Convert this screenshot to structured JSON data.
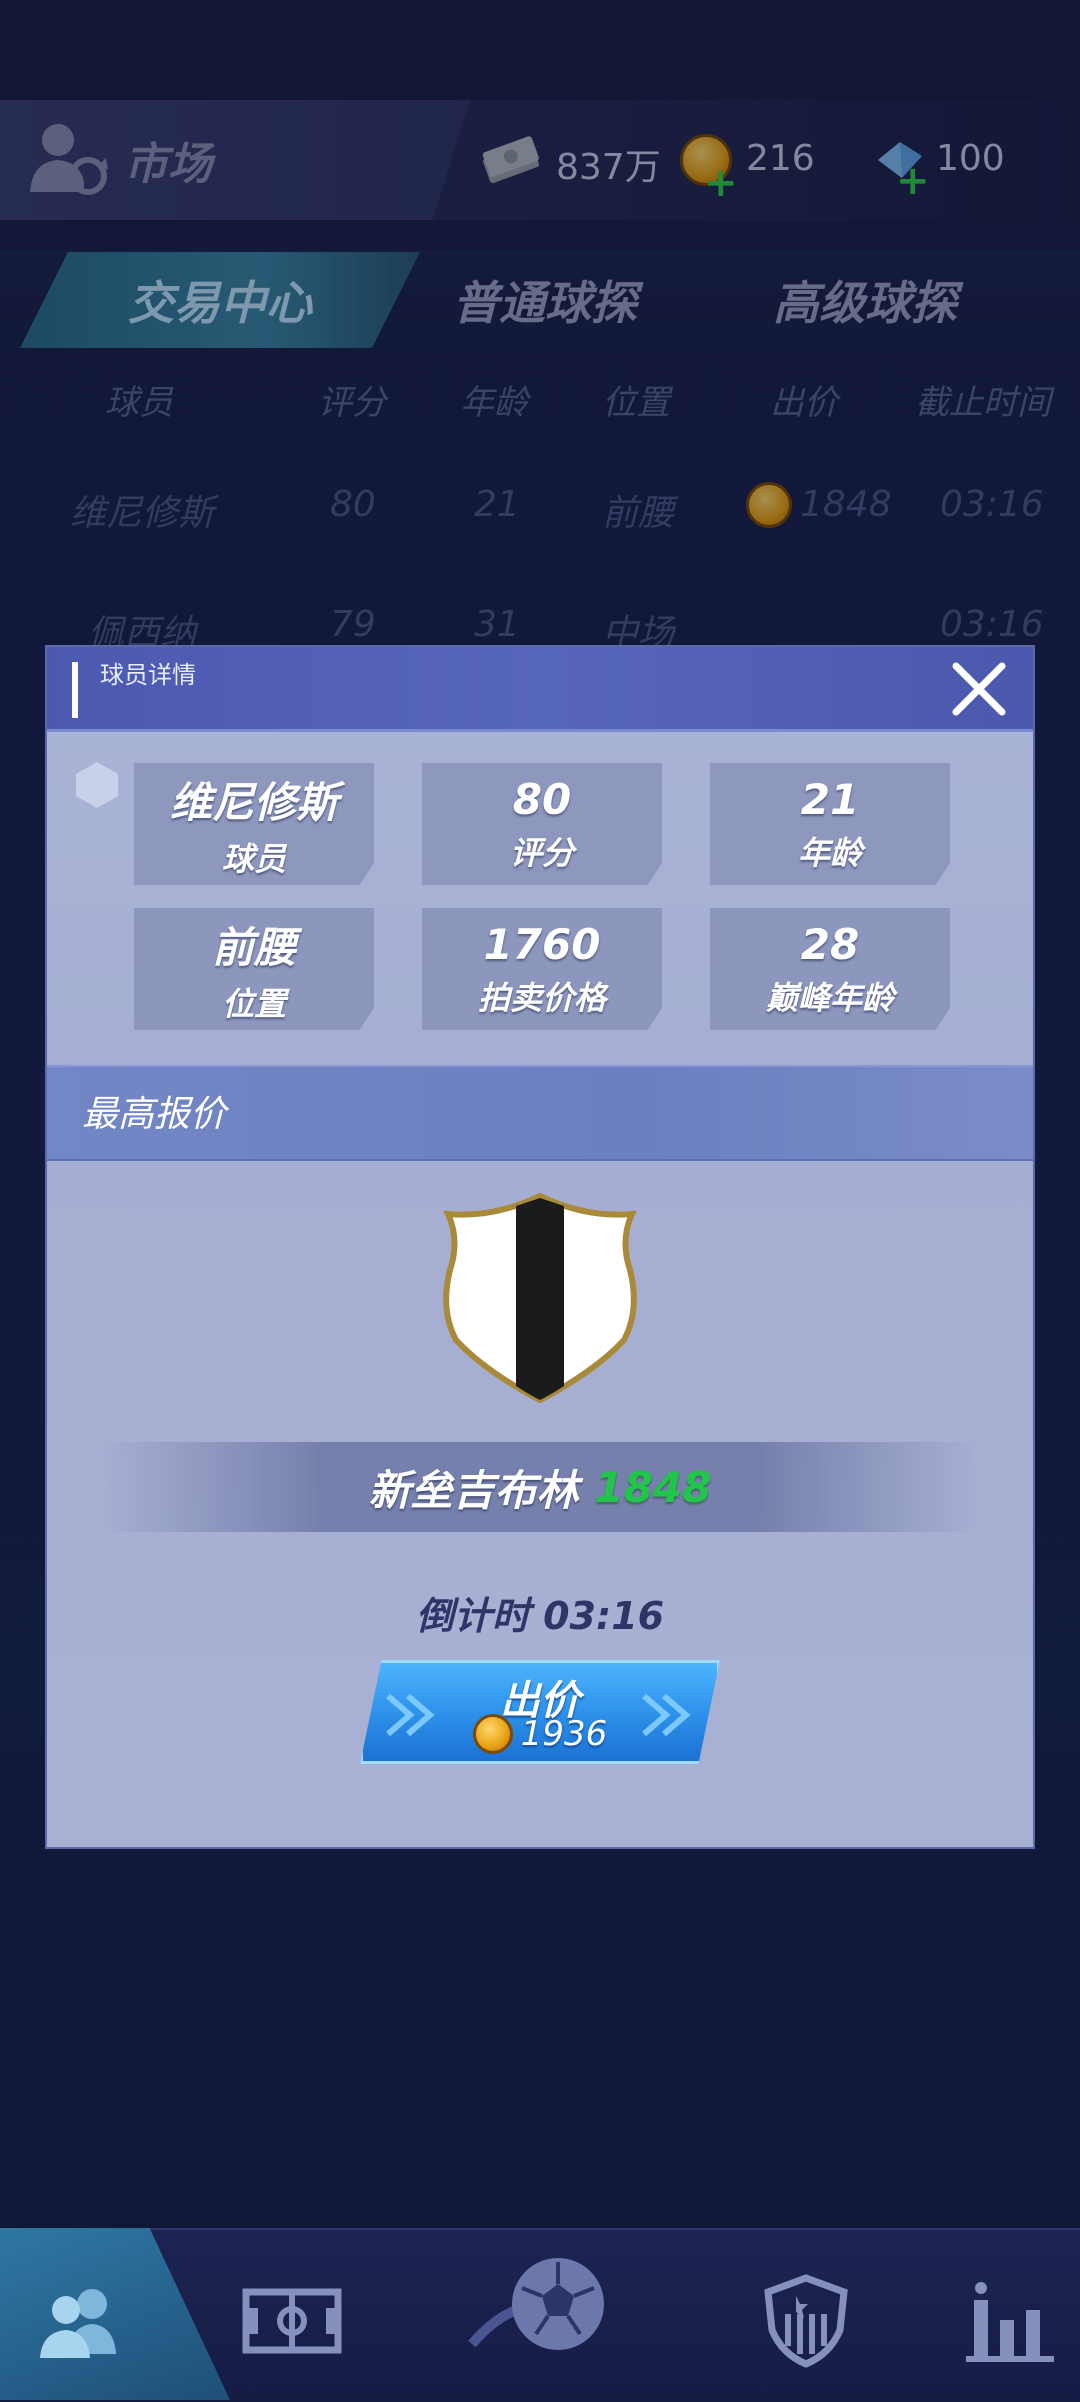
{
  "header": {
    "title": "市场",
    "cash": "837万",
    "coins": "216",
    "gems": "100"
  },
  "tabs": [
    {
      "label": "交易中心",
      "active": true
    },
    {
      "label": "普通球探",
      "active": false
    },
    {
      "label": "高级球探",
      "active": false
    }
  ],
  "list": {
    "columns": [
      "球员",
      "评分",
      "年龄",
      "位置",
      "出价",
      "截止时间"
    ],
    "rows": [
      {
        "name": "维尼修斯",
        "rating": "80",
        "age": "21",
        "position": "前腰",
        "bid": "1848",
        "deadline": "03:16"
      },
      {
        "name": "佩西纳",
        "rating": "79",
        "age": "31",
        "position": "中场",
        "bid": "",
        "deadline": "03:16"
      }
    ]
  },
  "modal": {
    "title": "球员详情",
    "stats": [
      {
        "value": "维尼修斯",
        "label": "球员"
      },
      {
        "value": "80",
        "label": "评分"
      },
      {
        "value": "21",
        "label": "年龄"
      },
      {
        "value": "前腰",
        "label": "位置"
      },
      {
        "value": "1760",
        "label": "拍卖价格"
      },
      {
        "value": "28",
        "label": "巅峰年龄"
      }
    ],
    "highest_offer_label": "最高报价",
    "bidder_name": "新垒吉布林",
    "bidder_amount": "1848",
    "countdown": "倒计时 03:16",
    "bid_button": {
      "label": "出价",
      "price": "1936"
    }
  },
  "colors": {
    "accent_blue": "#2b8fe8",
    "bid_green": "#1fc64a",
    "modal_header": "#5060b6"
  },
  "icons": {
    "profile": "user-switch-icon",
    "cash": "cash-stack-icon",
    "coin": "gold-coin-icon",
    "gem": "gem-icon",
    "close": "close-icon",
    "club_crest": "club-crest-icon",
    "nav": [
      "team-icon",
      "pitch-icon",
      "soccer-ball-icon",
      "club-badge-icon",
      "stats-icon"
    ]
  }
}
